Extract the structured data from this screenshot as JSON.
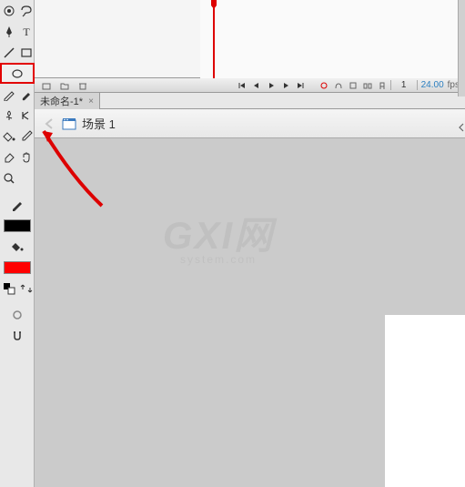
{
  "tools": {
    "3d_rotate": "3d-rotate-tool",
    "lasso": "lasso-tool",
    "pen": "pen-tool",
    "text": "text-tool",
    "line": "line-tool",
    "rectangle": "rectangle-tool",
    "oval": "oval-tool",
    "pencil": "pencil-tool",
    "brush": "brush-tool",
    "deco": "deco-tool",
    "bone": "bone-tool",
    "paint_bucket": "paint-bucket-tool",
    "eyedropper": "eyedropper-tool",
    "eraser": "eraser-tool",
    "hand": "hand-tool",
    "zoom": "zoom-tool"
  },
  "colors": {
    "stroke": "#000000",
    "fill": "#ff0000"
  },
  "document": {
    "tab_title": "未命名-1*",
    "scene_label": "场景 1"
  },
  "timeline": {
    "frame": "1",
    "fps": "24.00",
    "fps_label": "fps"
  },
  "watermark": {
    "main": "GXI网",
    "sub": "system.com"
  }
}
